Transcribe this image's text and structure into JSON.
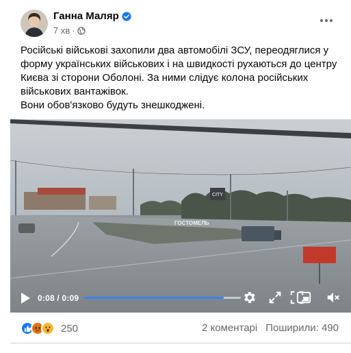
{
  "post": {
    "author": "Ганна Маляр",
    "time": "7 хв",
    "text_lines": [
      "Російські військові захопили два автомобілі ЗСУ, переодяглися у формуукраїнських військових і на швидкості рухаються до центру Києва зі сторони Оболоні. За ними слідує колона російських військових вантажівок.",
      "Вони обов'язково будуть знешкоджені."
    ],
    "text_p1_l1": "Російські військові захопили два автомобілі ЗСУ, переодяглися у",
    "text_p1_l2": "форму українських військових і на швидкості рухаються до центру",
    "text_p1_l3": "Києва зі сторони Оболоні. За ними слідує колона російських",
    "text_p1_l4": "військових вантажівок.",
    "text_p2": "Вони обов'язково будуть знешкоджені."
  },
  "video": {
    "current_time": "0:08",
    "duration": "0:09",
    "time_display": "0:08 / 0:09",
    "progress": 0.89,
    "sign_text": "ГОСТОМЕЛЬ",
    "city_sign": "CITY"
  },
  "footer": {
    "reaction_count": "250",
    "comments": "2 коментарі",
    "shares": "Поширили: 490"
  },
  "colors": {
    "verified": "#1877f2",
    "progress": "#3b82f6",
    "like": "#1877f2",
    "angry": "#e9710f",
    "wow": "#f7b928"
  },
  "icons": [
    "verified-badge-icon",
    "globe-icon",
    "more-options-icon",
    "play-icon",
    "settings-icon",
    "fullscreen-icon",
    "picture-in-picture-icon",
    "volume-muted-icon",
    "like-reaction-icon",
    "angry-reaction-icon",
    "wow-reaction-icon"
  ]
}
